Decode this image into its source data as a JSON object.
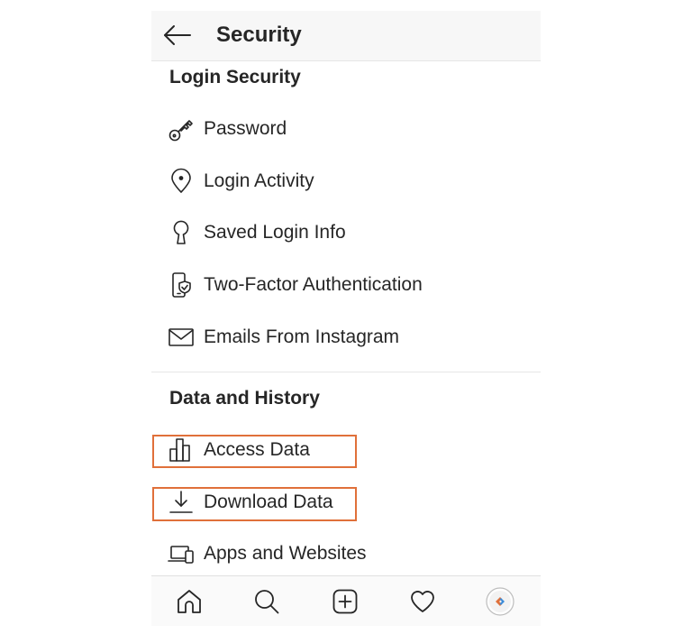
{
  "header": {
    "title": "Security"
  },
  "sections": {
    "login_security": {
      "title": "Login Security",
      "items": [
        {
          "label": "Password",
          "icon": "key-icon"
        },
        {
          "label": "Login Activity",
          "icon": "location-pin-icon"
        },
        {
          "label": "Saved Login Info",
          "icon": "keyhole-icon"
        },
        {
          "label": "Two-Factor Authentication",
          "icon": "phone-shield-icon"
        },
        {
          "label": "Emails From Instagram",
          "icon": "envelope-icon"
        }
      ]
    },
    "data_history": {
      "title": "Data and History",
      "items": [
        {
          "label": "Access Data",
          "icon": "bar-chart-icon"
        },
        {
          "label": "Download Data",
          "icon": "download-icon"
        },
        {
          "label": "Apps and Websites",
          "icon": "devices-icon"
        }
      ]
    }
  },
  "bottom_nav": [
    {
      "icon": "home-icon"
    },
    {
      "icon": "search-icon"
    },
    {
      "icon": "add-post-icon"
    },
    {
      "icon": "heart-icon"
    },
    {
      "icon": "profile-avatar-icon"
    }
  ],
  "colors": {
    "text": "#262626",
    "header_bg": "#f7f7f7",
    "divider": "#e6e6e6",
    "highlight": "#e0703a",
    "nav_bg": "#fafafa"
  }
}
